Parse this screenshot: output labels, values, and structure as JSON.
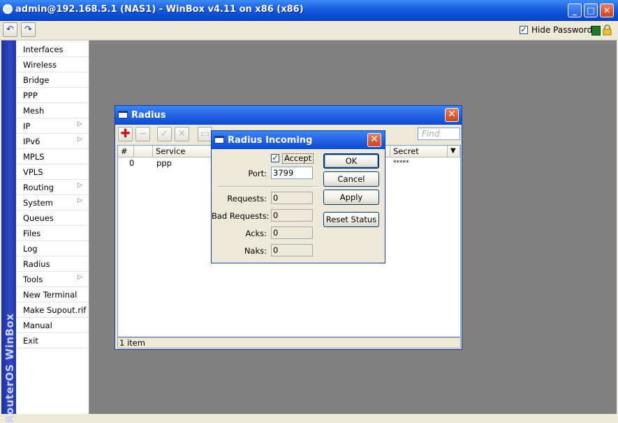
{
  "app": {
    "title": "admin@192.168.5.1 (NAS1) - WinBox v4.11 on x86 (x86)",
    "brand": "RouterOS WinBox",
    "toolbar": {
      "undo_icon": "undo-icon",
      "redo_icon": "redo-icon",
      "hide_passwords_label": "Hide Passwords",
      "hide_passwords_checked": true
    }
  },
  "sidebar": {
    "items": [
      {
        "label": "Interfaces",
        "submenu": false
      },
      {
        "label": "Wireless",
        "submenu": false
      },
      {
        "label": "Bridge",
        "submenu": false
      },
      {
        "label": "PPP",
        "submenu": false
      },
      {
        "label": "Mesh",
        "submenu": false
      },
      {
        "label": "IP",
        "submenu": true
      },
      {
        "label": "IPv6",
        "submenu": true
      },
      {
        "label": "MPLS",
        "submenu": false
      },
      {
        "label": "VPLS",
        "submenu": false
      },
      {
        "label": "Routing",
        "submenu": true
      },
      {
        "label": "System",
        "submenu": true
      },
      {
        "label": "Queues",
        "submenu": false
      },
      {
        "label": "Files",
        "submenu": false
      },
      {
        "label": "Log",
        "submenu": false
      },
      {
        "label": "Radius",
        "submenu": false
      },
      {
        "label": "Tools",
        "submenu": true
      },
      {
        "label": "New Terminal",
        "submenu": false
      },
      {
        "label": "Make Supout.rif",
        "submenu": false
      },
      {
        "label": "Manual",
        "submenu": false
      },
      {
        "label": "Exit",
        "submenu": false
      }
    ]
  },
  "radius_window": {
    "title": "Radius",
    "find_placeholder": "Find",
    "columns": [
      "#",
      "",
      "Service",
      "Secret"
    ],
    "rows": [
      {
        "num": "0",
        "flag": "",
        "service": "ppp",
        "secret": "*****"
      }
    ],
    "status": "1 item"
  },
  "radius_incoming": {
    "title": "Radius Incoming",
    "accept_label": "Accept",
    "accept_checked": true,
    "port_label": "Port:",
    "port_value": "3799",
    "requests_label": "Requests:",
    "requests_value": "0",
    "bad_requests_label": "Bad Requests:",
    "bad_requests_value": "0",
    "acks_label": "Acks:",
    "acks_value": "0",
    "naks_label": "Naks:",
    "naks_value": "0",
    "buttons": {
      "ok": "OK",
      "cancel": "Cancel",
      "apply": "Apply",
      "reset_status": "Reset Status"
    }
  }
}
